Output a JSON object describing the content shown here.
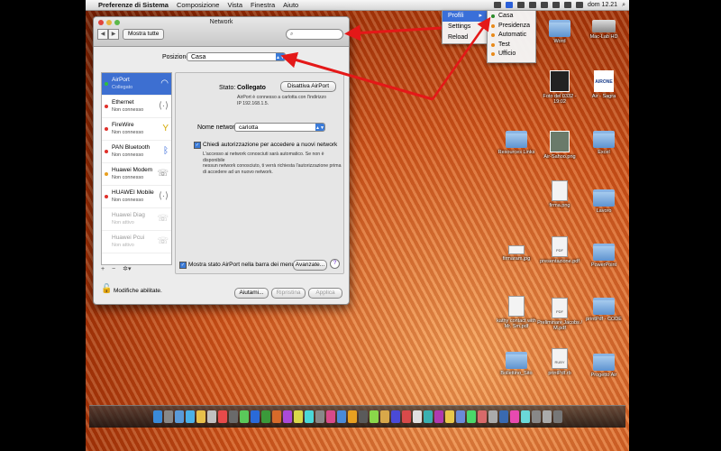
{
  "menubar": {
    "app": "Preferenze di Sistema",
    "items": [
      "Composizione",
      "Vista",
      "Finestra",
      "Aiuto"
    ],
    "clock": "dom 12.21"
  },
  "profiles_menu": {
    "items": [
      "Profili",
      "Settings",
      "Reload"
    ],
    "highlighted": "Profili"
  },
  "profiles_submenu": {
    "items": [
      "Casa",
      "Presidenza",
      "Automatic",
      "Test",
      "Ufficio"
    ]
  },
  "window": {
    "title": "Network",
    "show_all": "Mostra tutte",
    "search_placeholder": "",
    "location_label": "Posizione:",
    "location_value": "Casa",
    "services": [
      {
        "name": "AirPort",
        "status": "Collegato",
        "color": "#2fbf3a",
        "icon": "wifi-icon"
      },
      {
        "name": "Ethernet",
        "status": "Non connesso",
        "color": "#e0302a",
        "icon": "ethernet-icon"
      },
      {
        "name": "FireWire",
        "status": "Non connesso",
        "color": "#e0302a",
        "icon": "firewire-icon"
      },
      {
        "name": "PAN Bluetooth",
        "status": "Non connesso",
        "color": "#e0302a",
        "icon": "bluetooth-icon"
      },
      {
        "name": "Huawei Modem",
        "status": "Non connesso",
        "color": "#e8a020",
        "icon": "phone-icon"
      },
      {
        "name": "HUAWEI Mobile",
        "status": "Non connesso",
        "color": "#e0302a",
        "icon": "ethernet-icon"
      },
      {
        "name": "Huawei Diag",
        "status": "Non attivo",
        "color": "",
        "icon": "phone-icon"
      },
      {
        "name": "Huawei Pcui",
        "status": "Non attivo",
        "color": "",
        "icon": "phone-icon"
      }
    ],
    "status_label": "Stato:",
    "status_value": "Collegato",
    "disable_airport": "Disattiva AirPort",
    "status_desc_1": "AirPort è connesso a carlotta con l'indirizzo",
    "status_desc_2": "IP 192.168.1.5.",
    "network_name_label": "Nome network:",
    "network_name_value": "carlotta",
    "ask_join_label": "Chiedi autorizzazione per accedere a nuovi network",
    "ask_desc_1": "L'accesso ai network conosciuti sarà automatico. Se non è disponibile",
    "ask_desc_2": "nessun network conosciuto, ti verrà richiesta l'autorizzazione prima",
    "ask_desc_3": "di accedere ad un nuovo network.",
    "show_status_label": "Mostra stato AirPort nella barra dei menu",
    "advanced": "Avanzate...",
    "help": "?",
    "lock_label": "Modifiche abilitate.",
    "assist": "Aiutami...",
    "revert": "Ripristina",
    "apply": "Applica"
  },
  "desktop_icons": [
    {
      "label": "Word",
      "kind": "folder"
    },
    {
      "label": "Mac-Lab HD",
      "kind": "hdd"
    },
    {
      "label": "Foto del 0332 - 19:02",
      "kind": "img"
    },
    {
      "label": "Air - Sagra",
      "kind": "img-white",
      "text": "AIRONE"
    },
    {
      "label": "Resources Links",
      "kind": "folder"
    },
    {
      "label": "Air-Sahoo.png",
      "kind": "img"
    },
    {
      "label": "Excel",
      "kind": "folder"
    },
    {
      "label": "firma.png",
      "kind": "doc"
    },
    {
      "label": "Lavoro",
      "kind": "folder"
    },
    {
      "label": "firmaram.jpg",
      "kind": "doc"
    },
    {
      "label": "presentazione.pdf",
      "kind": "doc",
      "text": "PDF"
    },
    {
      "label": "PowerPoint",
      "kind": "folder"
    },
    {
      "label": "kathy contact with Mr. Sm.pdf",
      "kind": "doc"
    },
    {
      "label": "Preliminare Jacobs / M.pdf",
      "kind": "doc",
      "text": "PDF"
    },
    {
      "label": "printPdf - CODE",
      "kind": "folder"
    },
    {
      "label": "Bollettino_Sito",
      "kind": "folder"
    },
    {
      "label": "printPdf.rb",
      "kind": "doc",
      "text": "RUBY"
    },
    {
      "label": "Progetto Air",
      "kind": "folder"
    }
  ]
}
